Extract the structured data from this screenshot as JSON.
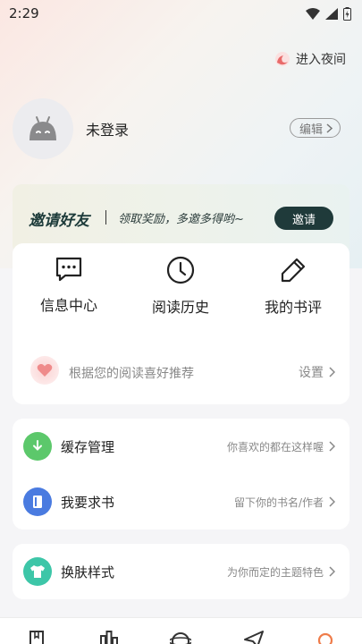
{
  "status": {
    "time": "2:29"
  },
  "header": {
    "night_mode_label": "进入夜间"
  },
  "profile": {
    "login_text": "未登录",
    "edit_label": "编辑"
  },
  "invite": {
    "title": "邀请好友",
    "subtitle": "领取奖励，多邀多得哟~",
    "button_label": "邀请"
  },
  "quick_actions": [
    {
      "label": "信息中心",
      "icon": "message-icon"
    },
    {
      "label": "阅读历史",
      "icon": "clock-icon"
    },
    {
      "label": "我的书评",
      "icon": "pen-icon"
    }
  ],
  "recommend": {
    "text": "根据您的阅读喜好推荐",
    "setting_label": "设置"
  },
  "list_group_1": [
    {
      "label": "缓存管理",
      "hint": "你喜欢的都在这样喔",
      "icon": "download-icon",
      "color": "#5cc86b"
    },
    {
      "label": "我要求书",
      "hint": "留下你的书名/作者",
      "icon": "book-icon",
      "color": "#4a7be0"
    }
  ],
  "list_group_2": [
    {
      "label": "换肤样式",
      "hint": "为你而定的主题特色",
      "icon": "shirt-icon",
      "color": "#3dc6a8"
    }
  ],
  "colors": {
    "accent_dark": "#1f3a3a",
    "night_icon": "#e86a6a"
  },
  "bottom_nav": [
    "bookshelf-icon",
    "ranking-icon",
    "discover-icon",
    "send-icon",
    "profile-icon"
  ]
}
